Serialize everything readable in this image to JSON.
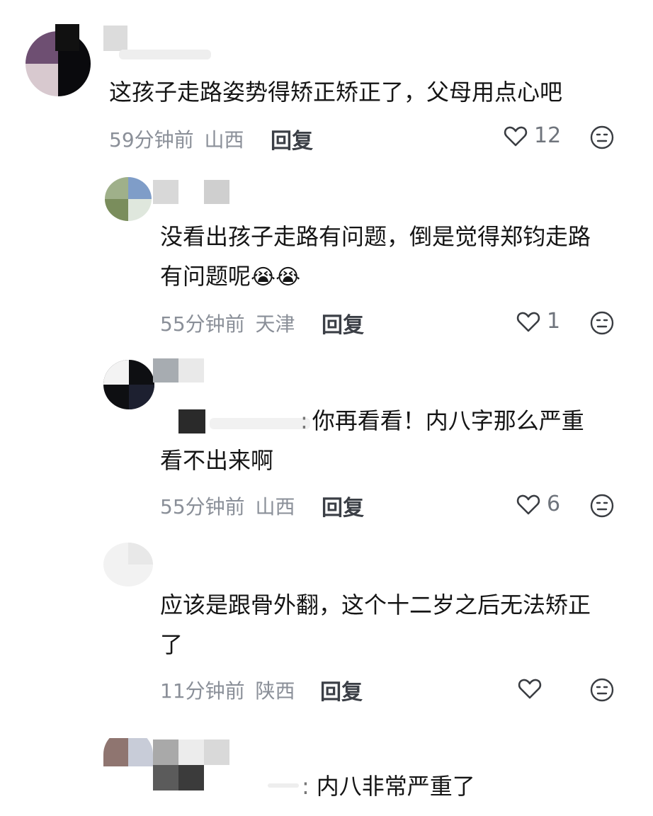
{
  "comments": [
    {
      "text": "这孩子走路姿势得矫正矫正了，父母用点心吧",
      "time": "59分钟前",
      "location": "山西",
      "reply_label": "回复",
      "likes": "12"
    },
    {
      "text_line1": "没看出孩子走路有问题，倒是觉得郑钧走路",
      "text_line2": "有问题呢",
      "emoji": "😭😭",
      "time": "55分钟前",
      "location": "天津",
      "reply_label": "回复",
      "likes": "1"
    },
    {
      "reply_sep": ":",
      "text_line1": "你再看看！内八字那么严重",
      "text_line2": "看不出来啊",
      "time": "55分钟前",
      "location": "山西",
      "reply_label": "回复",
      "likes": "6"
    },
    {
      "text_line1": "应该是跟骨外翻，这个十二岁之后无法矫正",
      "text_line2": "了",
      "time": "11分钟前",
      "location": "陕西",
      "reply_label": "回复",
      "likes": ""
    },
    {
      "reply_sep": ":",
      "text_line1": "内八非常严重了"
    }
  ],
  "icons": {
    "like": "heart-outline-icon",
    "dislike": "neutral-face-icon"
  },
  "colors": {
    "meta": "#8a8f98",
    "text": "#151515",
    "icon": "#3a3d42"
  }
}
